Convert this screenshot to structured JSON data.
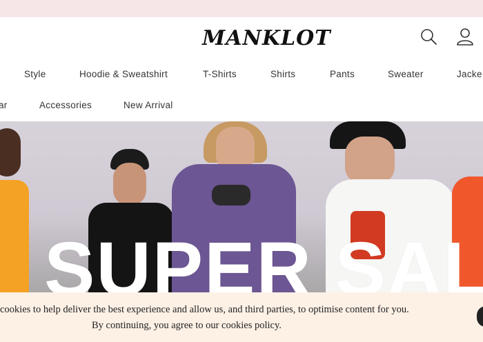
{
  "brand": {
    "logo_text": "MANKLOT"
  },
  "header": {
    "icons": [
      "search-icon",
      "user-icon"
    ]
  },
  "nav": {
    "row1": [
      "Style",
      "Hoodie & Sweatshirt",
      "T-Shirts",
      "Shirts",
      "Pants",
      "Sweater",
      "Jacke"
    ],
    "row2": [
      "ar",
      "Accessories",
      "New Arrival"
    ]
  },
  "hero": {
    "title": "SUPER SALE"
  },
  "cookie": {
    "line1": "cookies to help deliver the best experience and allow us, and third parties, to optimise content for you.",
    "line2": "By continuing, you agree to our cookies policy."
  },
  "colors": {
    "topbar": "#f6e6e7",
    "cookie_bg": "#fdf1e6",
    "hero_text": "#ffffff"
  }
}
